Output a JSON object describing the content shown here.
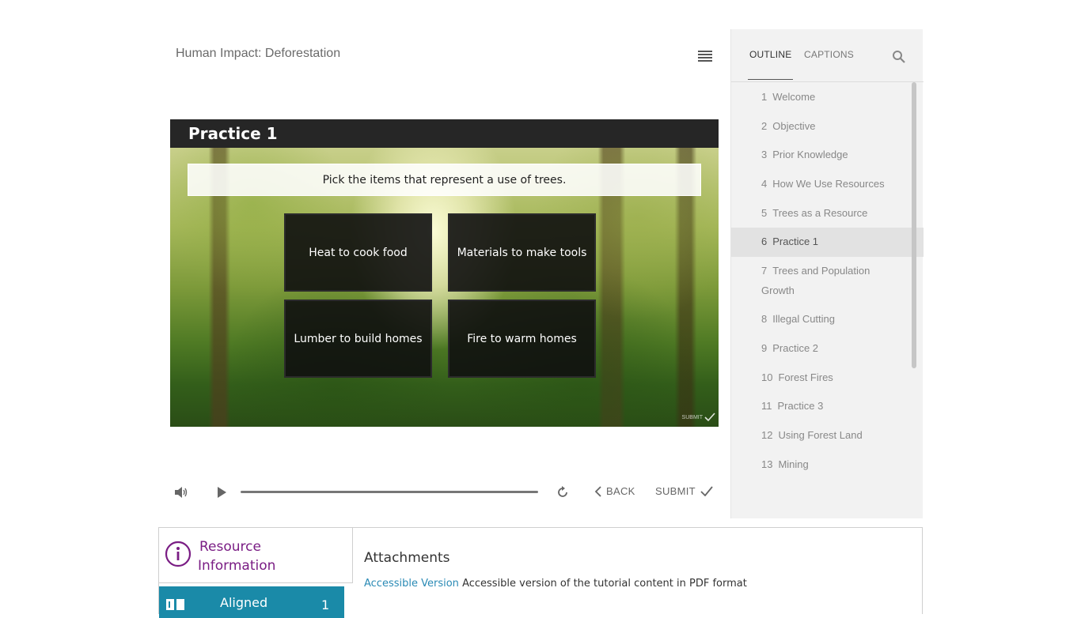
{
  "player": {
    "title": "Human Impact: Deforestation",
    "menu_icon": "hamburger-menu-icon"
  },
  "slide": {
    "header": "Practice 1",
    "prompt": "Pick the items that represent a use of trees.",
    "choices": [
      "Heat to cook food",
      "Materials to make tools",
      "Lumber to build homes",
      "Fire to warm homes"
    ],
    "mini_submit": "SUBMIT"
  },
  "controls": {
    "volume_icon": "volume-icon",
    "play_icon": "play-icon",
    "replay_icon": "replay-icon",
    "back_label": "BACK",
    "submit_label": "SUBMIT"
  },
  "sidebar": {
    "tabs": [
      "OUTLINE",
      "CAPTIONS"
    ],
    "active_tab": "OUTLINE",
    "search_icon": "search-icon",
    "outline": [
      {
        "num": "1",
        "label": "Welcome"
      },
      {
        "num": "2",
        "label": "Objective"
      },
      {
        "num": "3",
        "label": "Prior Knowledge"
      },
      {
        "num": "4",
        "label": "How We Use Resources"
      },
      {
        "num": "5",
        "label": "Trees as a Resource"
      },
      {
        "num": "6",
        "label": "Practice 1"
      },
      {
        "num": "7",
        "label": "Trees and Population Growth"
      },
      {
        "num": "8",
        "label": "Illegal Cutting"
      },
      {
        "num": "9",
        "label": "Practice 2"
      },
      {
        "num": "10",
        "label": "Forest Fires"
      },
      {
        "num": "11",
        "label": "Practice 3"
      },
      {
        "num": "12",
        "label": "Using Forest Land"
      },
      {
        "num": "13",
        "label": "Mining"
      }
    ],
    "active_item": "6"
  },
  "bottom": {
    "resource_line1": "Resource",
    "resource_line2": "Information",
    "aligned_label": "Aligned",
    "aligned_count": "1",
    "attachments_title": "Attachments",
    "attachment_link": "Accessible Version",
    "attachment_desc": "Accessible version of the tutorial content in PDF format",
    "brand_color": "#7a1d84",
    "aligned_color": "#1a8aa8"
  }
}
